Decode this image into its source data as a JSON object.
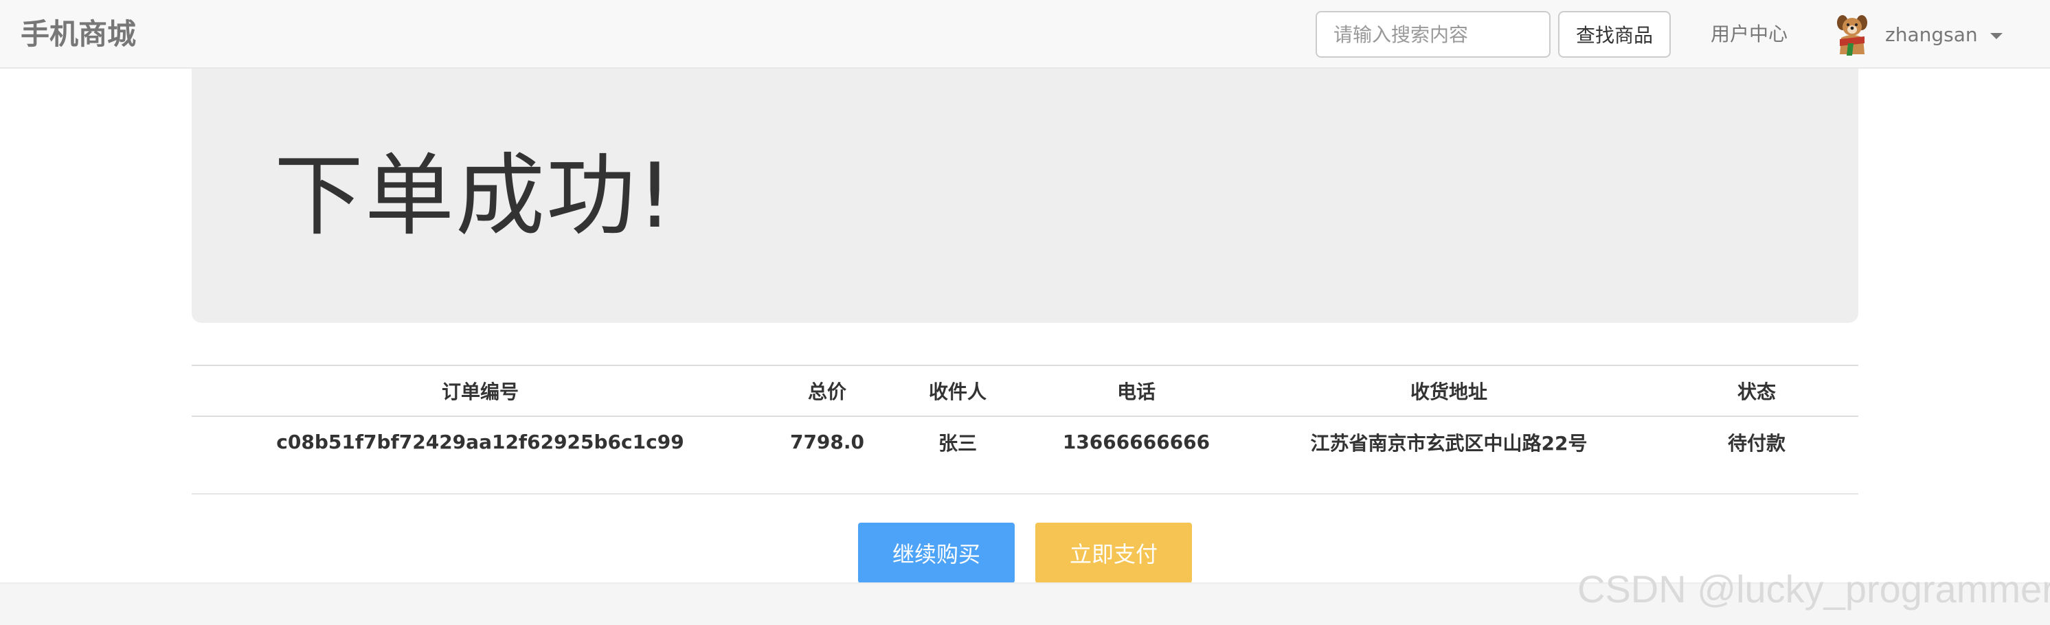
{
  "navbar": {
    "brand": "手机商城",
    "search_placeholder": "请输入搜索内容",
    "search_button": "查找商品",
    "user_center": "用户中心",
    "username": "zhangsan",
    "avatar_icon": "dog-avatar-icon",
    "caret_icon": "caret-down-icon"
  },
  "jumbotron": {
    "title": "下单成功!"
  },
  "order_table": {
    "headers": [
      "订单编号",
      "总价",
      "收件人",
      "电话",
      "收货地址",
      "状态"
    ],
    "rows": [
      {
        "order_no": "c08b51f7bf72429aa12f62925b6c1c99",
        "total": "7798.0",
        "recipient": "张三",
        "phone": "13666666666",
        "address": "江苏省南京市玄武区中山路22号",
        "status": "待付款"
      }
    ]
  },
  "actions": {
    "continue_label": "继续购买",
    "pay_label": "立即支付",
    "continue_color": "#4da3f7",
    "pay_color": "#f5c452"
  },
  "watermark": "CSDN @lucky_programmer"
}
